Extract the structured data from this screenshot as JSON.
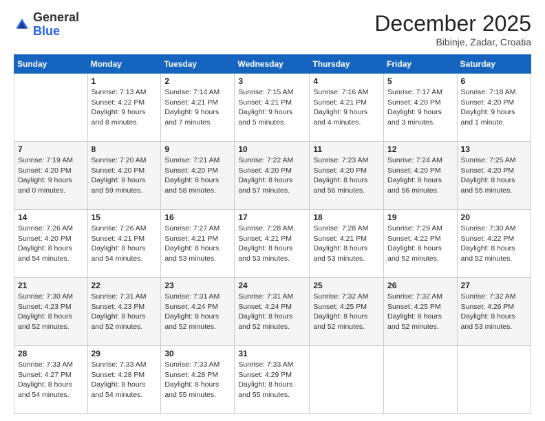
{
  "logo": {
    "general": "General",
    "blue": "Blue"
  },
  "title": "December 2025",
  "subtitle": "Bibinje, Zadar, Croatia",
  "days_header": [
    "Sunday",
    "Monday",
    "Tuesday",
    "Wednesday",
    "Thursday",
    "Friday",
    "Saturday"
  ],
  "weeks": [
    [
      {
        "day": "",
        "info": ""
      },
      {
        "day": "1",
        "info": "Sunrise: 7:13 AM\nSunset: 4:22 PM\nDaylight: 9 hours\nand 8 minutes."
      },
      {
        "day": "2",
        "info": "Sunrise: 7:14 AM\nSunset: 4:21 PM\nDaylight: 9 hours\nand 7 minutes."
      },
      {
        "day": "3",
        "info": "Sunrise: 7:15 AM\nSunset: 4:21 PM\nDaylight: 9 hours\nand 5 minutes."
      },
      {
        "day": "4",
        "info": "Sunrise: 7:16 AM\nSunset: 4:21 PM\nDaylight: 9 hours\nand 4 minutes."
      },
      {
        "day": "5",
        "info": "Sunrise: 7:17 AM\nSunset: 4:20 PM\nDaylight: 9 hours\nand 3 minutes."
      },
      {
        "day": "6",
        "info": "Sunrise: 7:18 AM\nSunset: 4:20 PM\nDaylight: 9 hours\nand 1 minute."
      }
    ],
    [
      {
        "day": "7",
        "info": "Sunrise: 7:19 AM\nSunset: 4:20 PM\nDaylight: 9 hours\nand 0 minutes."
      },
      {
        "day": "8",
        "info": "Sunrise: 7:20 AM\nSunset: 4:20 PM\nDaylight: 8 hours\nand 59 minutes."
      },
      {
        "day": "9",
        "info": "Sunrise: 7:21 AM\nSunset: 4:20 PM\nDaylight: 8 hours\nand 58 minutes."
      },
      {
        "day": "10",
        "info": "Sunrise: 7:22 AM\nSunset: 4:20 PM\nDaylight: 8 hours\nand 57 minutes."
      },
      {
        "day": "11",
        "info": "Sunrise: 7:23 AM\nSunset: 4:20 PM\nDaylight: 8 hours\nand 56 minutes."
      },
      {
        "day": "12",
        "info": "Sunrise: 7:24 AM\nSunset: 4:20 PM\nDaylight: 8 hours\nand 56 minutes."
      },
      {
        "day": "13",
        "info": "Sunrise: 7:25 AM\nSunset: 4:20 PM\nDaylight: 8 hours\nand 55 minutes."
      }
    ],
    [
      {
        "day": "14",
        "info": "Sunrise: 7:26 AM\nSunset: 4:20 PM\nDaylight: 8 hours\nand 54 minutes."
      },
      {
        "day": "15",
        "info": "Sunrise: 7:26 AM\nSunset: 4:21 PM\nDaylight: 8 hours\nand 54 minutes."
      },
      {
        "day": "16",
        "info": "Sunrise: 7:27 AM\nSunset: 4:21 PM\nDaylight: 8 hours\nand 53 minutes."
      },
      {
        "day": "17",
        "info": "Sunrise: 7:28 AM\nSunset: 4:21 PM\nDaylight: 8 hours\nand 53 minutes."
      },
      {
        "day": "18",
        "info": "Sunrise: 7:28 AM\nSunset: 4:21 PM\nDaylight: 8 hours\nand 53 minutes."
      },
      {
        "day": "19",
        "info": "Sunrise: 7:29 AM\nSunset: 4:22 PM\nDaylight: 8 hours\nand 52 minutes."
      },
      {
        "day": "20",
        "info": "Sunrise: 7:30 AM\nSunset: 4:22 PM\nDaylight: 8 hours\nand 52 minutes."
      }
    ],
    [
      {
        "day": "21",
        "info": "Sunrise: 7:30 AM\nSunset: 4:23 PM\nDaylight: 8 hours\nand 52 minutes."
      },
      {
        "day": "22",
        "info": "Sunrise: 7:31 AM\nSunset: 4:23 PM\nDaylight: 8 hours\nand 52 minutes."
      },
      {
        "day": "23",
        "info": "Sunrise: 7:31 AM\nSunset: 4:24 PM\nDaylight: 8 hours\nand 52 minutes."
      },
      {
        "day": "24",
        "info": "Sunrise: 7:31 AM\nSunset: 4:24 PM\nDaylight: 8 hours\nand 52 minutes."
      },
      {
        "day": "25",
        "info": "Sunrise: 7:32 AM\nSunset: 4:25 PM\nDaylight: 8 hours\nand 52 minutes."
      },
      {
        "day": "26",
        "info": "Sunrise: 7:32 AM\nSunset: 4:25 PM\nDaylight: 8 hours\nand 52 minutes."
      },
      {
        "day": "27",
        "info": "Sunrise: 7:32 AM\nSunset: 4:26 PM\nDaylight: 8 hours\nand 53 minutes."
      }
    ],
    [
      {
        "day": "28",
        "info": "Sunrise: 7:33 AM\nSunset: 4:27 PM\nDaylight: 8 hours\nand 54 minutes."
      },
      {
        "day": "29",
        "info": "Sunrise: 7:33 AM\nSunset: 4:28 PM\nDaylight: 8 hours\nand 54 minutes."
      },
      {
        "day": "30",
        "info": "Sunrise: 7:33 AM\nSunset: 4:28 PM\nDaylight: 8 hours\nand 55 minutes."
      },
      {
        "day": "31",
        "info": "Sunrise: 7:33 AM\nSunset: 4:29 PM\nDaylight: 8 hours\nand 55 minutes."
      },
      {
        "day": "",
        "info": ""
      },
      {
        "day": "",
        "info": ""
      },
      {
        "day": "",
        "info": ""
      }
    ]
  ]
}
